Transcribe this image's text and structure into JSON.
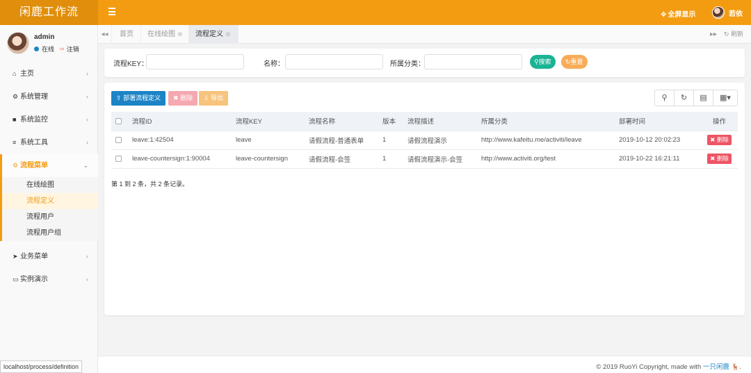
{
  "topbar": {
    "brand": "闲鹿工作流",
    "fullscreen_label": "全屏显示",
    "user_name": "若依"
  },
  "sidebar": {
    "user": {
      "name": "admin",
      "status": "在线",
      "logout": "注销"
    },
    "items": [
      {
        "label": "主页",
        "icon": "home-icon"
      },
      {
        "label": "系统管理",
        "icon": "gear-icon"
      },
      {
        "label": "系统监控",
        "icon": "video-icon"
      },
      {
        "label": "系统工具",
        "icon": "bars-icon"
      },
      {
        "label": "流程菜单",
        "icon": "gears-icon"
      },
      {
        "label": "业务菜单",
        "icon": "send-icon"
      },
      {
        "label": "实例演示",
        "icon": "desktop-icon"
      }
    ],
    "sub_items": [
      "在线绘图",
      "流程定义",
      "流程用户",
      "流程用户组"
    ]
  },
  "tabs": {
    "items": [
      "首页",
      "在线绘图",
      "流程定义"
    ],
    "refresh_label": "刷新"
  },
  "search": {
    "key_label": "流程KEY：",
    "name_label": "名称：",
    "category_label": "所属分类：",
    "search_btn": "搜索",
    "reset_btn": "重置"
  },
  "toolbar": {
    "deploy_label": "部署流程定义",
    "delete_label": "删除",
    "export_label": "导出"
  },
  "table": {
    "headers": [
      "流程ID",
      "流程KEY",
      "流程名称",
      "版本",
      "流程描述",
      "所属分类",
      "部署时间",
      "操作"
    ],
    "rows": [
      [
        "leave:1:42504",
        "leave",
        "请假流程-普通表单",
        "1",
        "请假流程演示",
        "http://www.kafeitu.me/activiti/leave",
        "2019-10-12 20:02:23",
        "删除"
      ],
      [
        "leave-countersign:1:90004",
        "leave-countersign",
        "请假流程-会签",
        "1",
        "请假流程演示-会签",
        "http://www.activiti.org/test",
        "2019-10-22 16:21:11",
        "删除"
      ]
    ],
    "summary": "第 1 到 2 条，共 2 条记录。"
  },
  "footer": {
    "copyright": "© 2019 RuoYi Copyright, made with",
    "author": "一只闲鹿"
  },
  "status_url": "localhost/process/definition",
  "colors": {
    "accent": "#f39c12",
    "primary": "#1c84c6",
    "success": "#1ab394",
    "danger": "#ed5565"
  }
}
